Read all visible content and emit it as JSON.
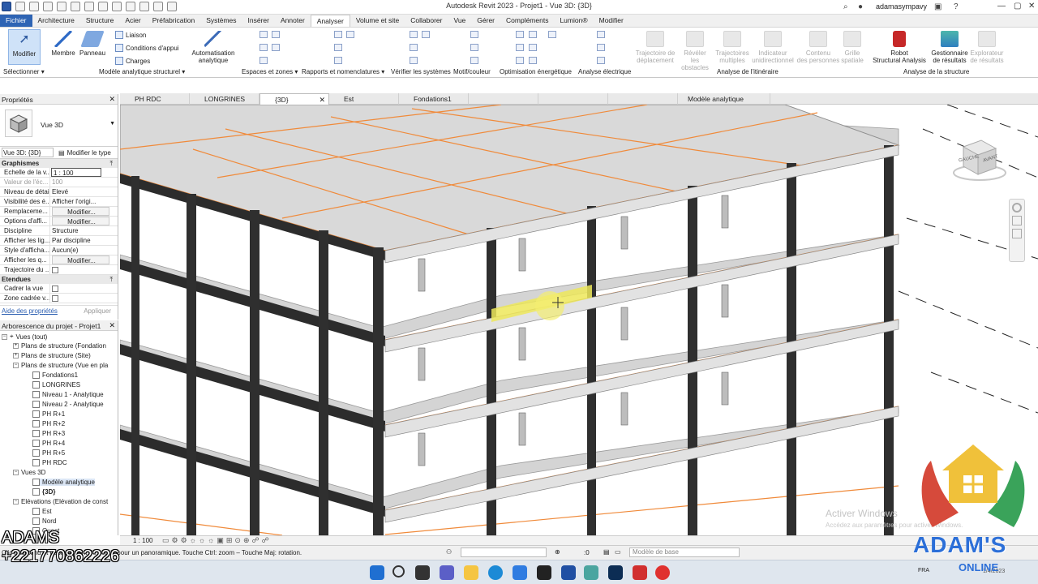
{
  "window": {
    "title": "Autodesk Revit 2023 - Projet1 - Vue 3D: {3D}",
    "user": "adamasympavy"
  },
  "menu": {
    "tabs": [
      "Fichier",
      "Architecture",
      "Structure",
      "Acier",
      "Préfabrication",
      "Systèmes",
      "Insérer",
      "Annoter",
      "Analyser",
      "Volume et site",
      "Collaborer",
      "Vue",
      "Gérer",
      "Compléments",
      "Lumion®",
      "Modifier"
    ],
    "active": "Analyser"
  },
  "ribbon": {
    "modifier": "Modifier",
    "membre": "Membre",
    "panneau": "Panneau",
    "liaison": "Liaison",
    "conditions": "Conditions d'appui",
    "charges": "Charges",
    "automatisation": [
      "Automatisation",
      "analytique"
    ],
    "trajectoire": [
      "Trajectoire de",
      "déplacement"
    ],
    "reveler": [
      "Révéler",
      "les obstacles"
    ],
    "trajectoires": [
      "Trajectoires",
      "multiples"
    ],
    "indicateur": [
      "Indicateur",
      "unidirectionnel"
    ],
    "contenu": [
      "Contenu",
      "des personnes"
    ],
    "grille": [
      "Grille",
      "spatiale"
    ],
    "robot": [
      "Robot",
      "Structural Analysis"
    ],
    "gestionnaire": [
      "Gestionnaire",
      "de résultats"
    ],
    "explorateur": [
      "Explorateur",
      "de résultats"
    ],
    "groups": [
      "Sélectionner ▾",
      "Modèle analytique structurel ▾",
      "Espaces et zones ▾",
      "Rapports et nomenclatures ▾",
      "Vérifier les systèmes",
      "Motif/couleur",
      "Optimisation énergétique",
      "Analyse électrique",
      "Analyse de l'itinéraire",
      "Analyse de la structure"
    ]
  },
  "properties": {
    "title": "Propriétés",
    "type": "Vue 3D",
    "selector": "Vue 3D: {3D}",
    "edit_type": "Modifier le type",
    "section_graphics": "Graphismes",
    "rows": [
      {
        "k": "Echelle de la v...",
        "v": "1 : 100"
      },
      {
        "k": "Valeur de l'éc...",
        "v": "100"
      },
      {
        "k": "Niveau de détail",
        "v": "Elevé"
      },
      {
        "k": "Visibilité des é...",
        "v": "Afficher l'origi..."
      },
      {
        "k": "Remplaceme...",
        "v": "Modifier..."
      },
      {
        "k": "Options d'affi...",
        "v": "Modifier..."
      },
      {
        "k": "Discipline",
        "v": "Structure"
      },
      {
        "k": "Afficher les lig...",
        "v": "Par discipline"
      },
      {
        "k": "Style d'afficha...",
        "v": "Aucun(e)"
      },
      {
        "k": "Afficher les q...",
        "v": "Modifier..."
      },
      {
        "k": "Trajectoire du ...",
        "v": ""
      }
    ],
    "section_extents": "Etendues",
    "extents": [
      {
        "k": "Cadrer la vue",
        "v": ""
      },
      {
        "k": "Zone cadrée v...",
        "v": ""
      }
    ],
    "help": "Aide des propriétés",
    "apply": "Appliquer"
  },
  "browser": {
    "title": "Arborescence du projet - Projet1",
    "nodes": [
      "Vues (tout)",
      "Plans de structure (Fondation",
      "Plans de structure (Site)",
      "Plans de structure (Vue en pla",
      "Fondations1",
      "LONGRINES",
      "Niveau 1 - Analytique",
      "Niveau 2 - Analytique",
      "PH R+1",
      "PH R+2",
      "PH R+3",
      "PH R+4",
      "PH R+5",
      "PH RDC",
      "Vues 3D",
      "Modèle analytique",
      "{3D}",
      "Elévations (Elévation de const",
      "Est",
      "Nord",
      "Ouest"
    ]
  },
  "tabs": [
    "PH RDC",
    "LONGRINES",
    "{3D}",
    "Est",
    "Fondations1",
    "",
    "",
    "",
    "Modèle analytique"
  ],
  "viewcube": {
    "left": "GAUCHE",
    "front": "AVANT"
  },
  "view_status": {
    "scale": "1 : 100"
  },
  "status": {
    "message": "Clic maintenu et déplacement de souris pour un panoramique. Touche Ctrl: zoom – Touche Maj: rotation.",
    "zero": ":0",
    "model": "Modèle de base"
  },
  "taskbar": {
    "lang": "FRA",
    "date": "1/4/2023"
  },
  "watermark": {
    "line1": "Activer Windows",
    "line2": "Accédez aux paramètres pour activer Windows."
  },
  "overlay": {
    "name": "ADAMS",
    "phone": "+221770862226",
    "brand1": "ADAM'S",
    "brand2": "ONLINE"
  },
  "colors": {
    "accent": "#2e64b4",
    "edge": "#f08a3a",
    "highlight": "#e6e04a",
    "column": "#2c2c2c",
    "slab": "#cfcfcf"
  }
}
